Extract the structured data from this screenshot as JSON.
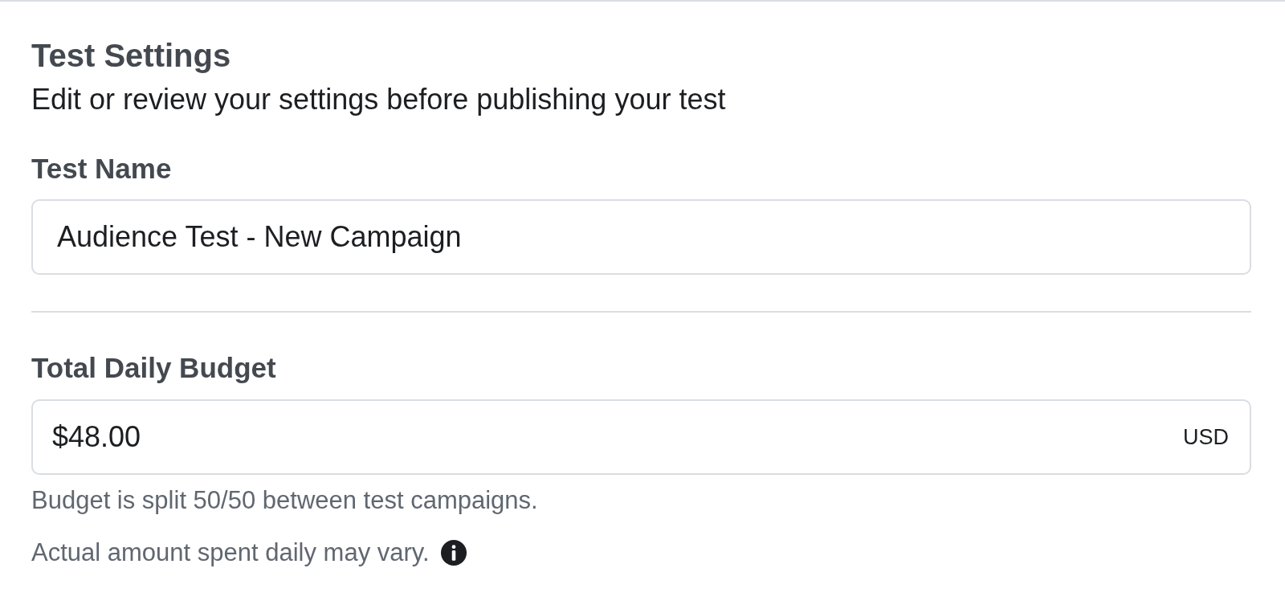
{
  "title": "Test Settings",
  "subtitle": "Edit or review your settings before publishing your test",
  "test_name": {
    "label": "Test Name",
    "value": "Audience Test - New Campaign"
  },
  "budget": {
    "label": "Total Daily Budget",
    "value": "$48.00",
    "currency": "USD"
  },
  "notes": [
    {
      "text": "Budget is split 50/50 between test campaigns.",
      "info": false
    },
    {
      "text": "Actual amount spent daily may vary.",
      "info": true
    }
  ]
}
